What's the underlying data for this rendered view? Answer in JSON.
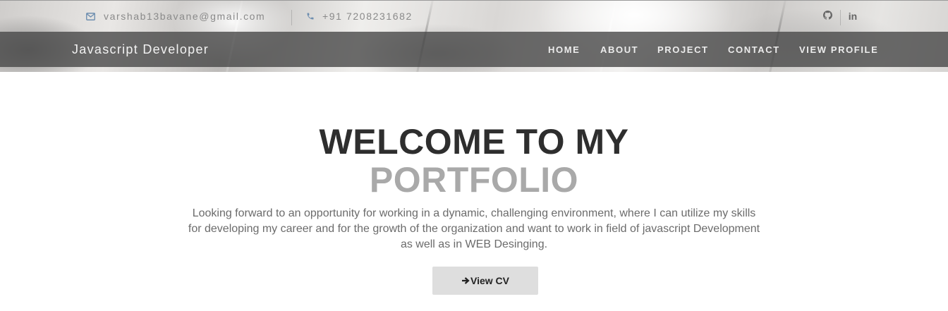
{
  "topbar": {
    "email": "varshab13bavane@gmail.com",
    "phone": "+91 7208231682",
    "email_icon": "envelope-icon",
    "phone_icon": "phone-icon",
    "social": [
      {
        "name": "github",
        "icon": "github-icon"
      },
      {
        "name": "linkedin",
        "label": "in",
        "icon": "linkedin-icon"
      }
    ]
  },
  "navbar": {
    "brand": "Javascript Developer",
    "items": [
      {
        "label": "HOME"
      },
      {
        "label": "ABOUT"
      },
      {
        "label": "PROJECT"
      },
      {
        "label": "CONTACT"
      },
      {
        "label": "VIEW PROFILE"
      }
    ]
  },
  "hero": {
    "title_line1": "WELCOME TO MY",
    "title_line2": "PORTFOLIO",
    "intro": "Looking forward to an opportunity for working in a dynamic, challenging environment, where I can utilize my skills for developing my career and for the growth of the organization and want to work in field of javascript Development as well as in WEB Desinging.",
    "cv_button": "View CV",
    "cv_icon": "arrow-right-icon"
  },
  "colors": {
    "navbar_bg": "#484848",
    "title_dark": "#2e2e2e",
    "title_light": "#a9a9a9",
    "body_text": "#6b6b6b",
    "button_bg": "#dedede"
  }
}
